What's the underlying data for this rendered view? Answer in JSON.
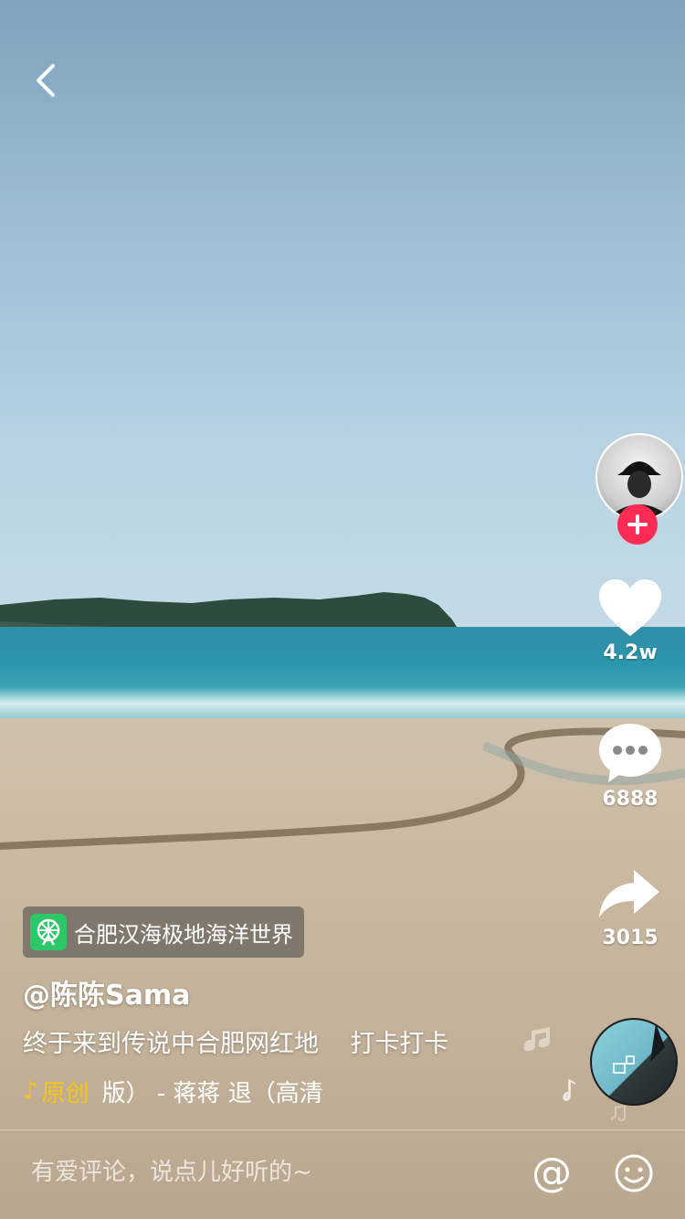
{
  "video": {
    "location_label": "合肥汉海极地海洋世界",
    "author": "@陈陈Sama",
    "caption": "终于来到传说中合肥网红地    打卡打卡",
    "music": {
      "tag": "原创",
      "title": "版）  - 蒋蒋    退（高清"
    }
  },
  "sidebar": {
    "like_count": "4.2w",
    "comment_count": "6888",
    "share_count": "3015"
  },
  "comment_bar": {
    "placeholder": "有爱评论，说点儿好听的~",
    "at_label": "@"
  },
  "colors": {
    "follow_button": "#fe2c55",
    "music_tag": "#f5c518",
    "location_icon_bg": "#2ec767"
  },
  "icons": {
    "back": "chevron-left-icon",
    "follow": "plus-icon",
    "like": "heart-icon",
    "comment": "speech-bubble-icon",
    "share": "share-arrow-icon",
    "music": "music-note-icon",
    "location": "ferris-wheel-icon",
    "emoji": "smiley-icon"
  }
}
